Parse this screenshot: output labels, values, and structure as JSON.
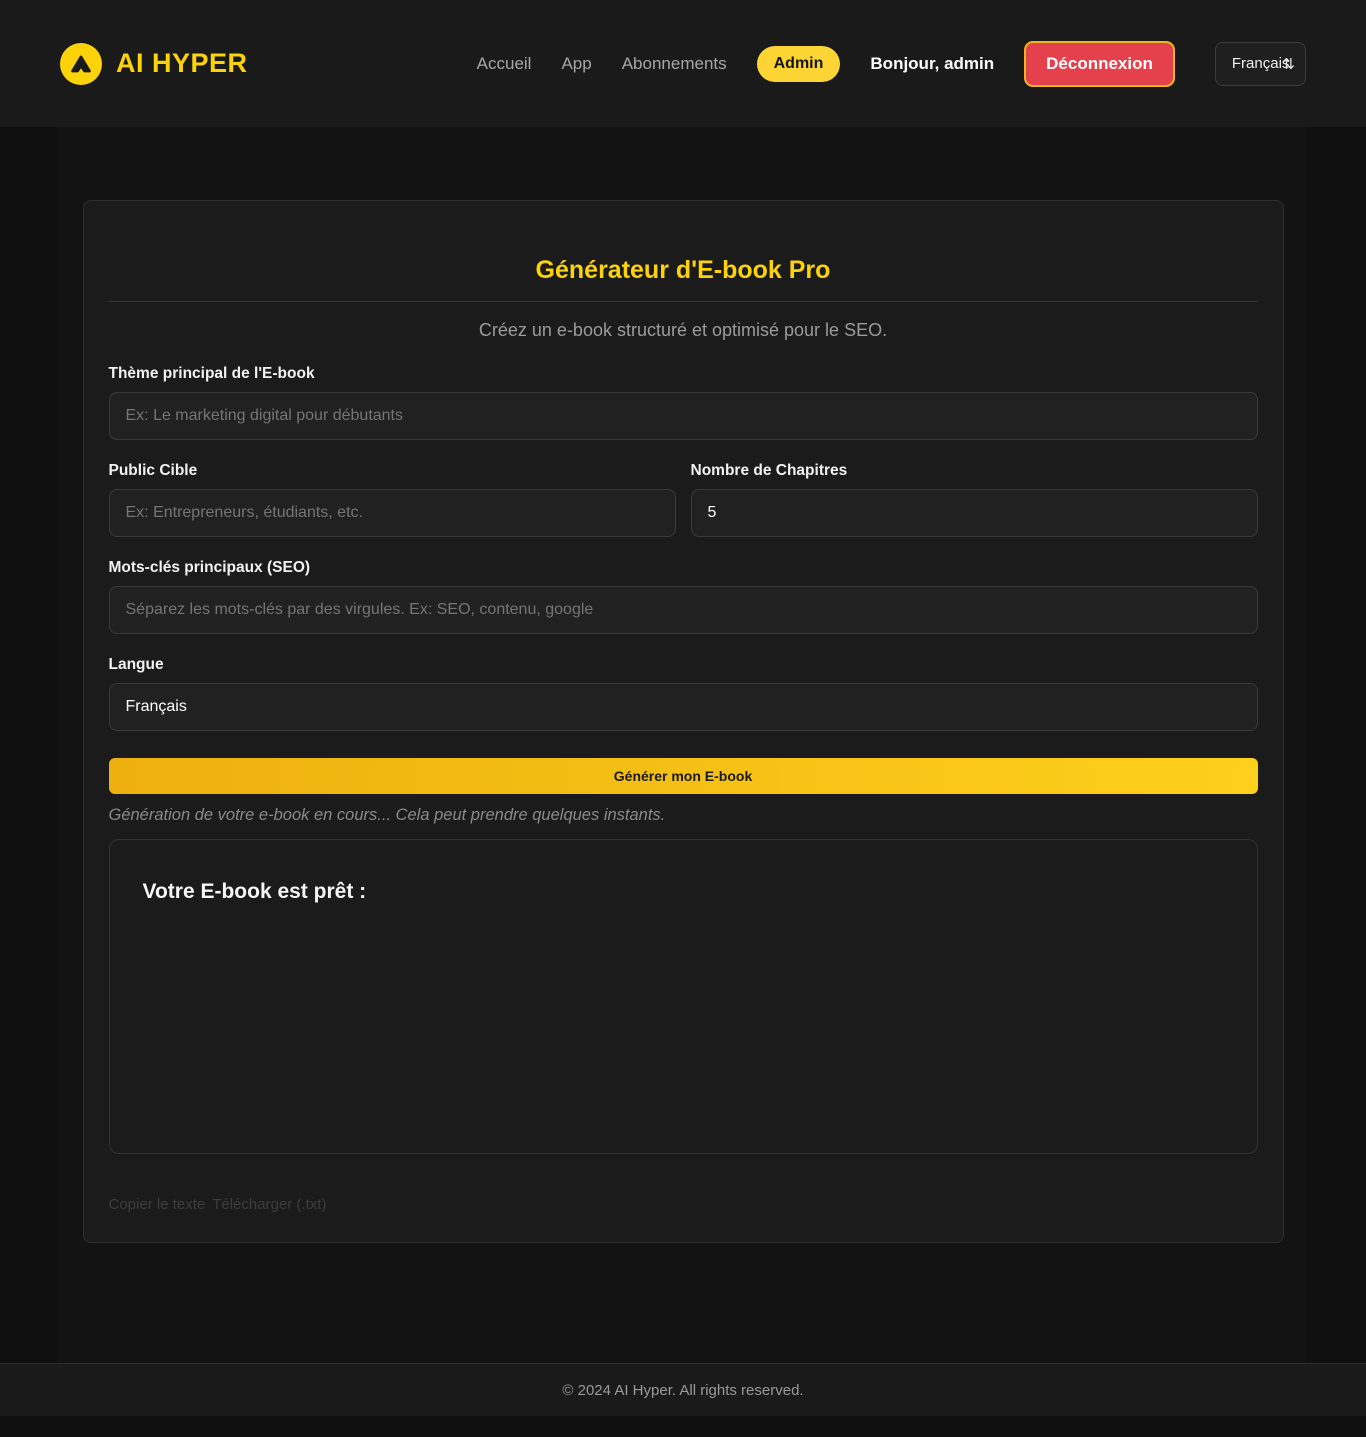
{
  "header": {
    "brand": "AI HYPER",
    "nav": [
      {
        "label": "Accueil"
      },
      {
        "label": "App"
      },
      {
        "label": "Abonnements"
      }
    ],
    "admin_badge": "Admin",
    "greeting": "Bonjour, admin",
    "logout_label": "Déconnexion",
    "language_selector": {
      "selected": "Français"
    }
  },
  "generator": {
    "title": "Générateur d'E-book Pro",
    "subtitle": "Créez un e-book structuré et optimisé pour le SEO.",
    "fields": {
      "theme": {
        "label": "Thème principal de l'E-book",
        "placeholder": "Ex: Le marketing digital pour débutants",
        "value": ""
      },
      "audience": {
        "label": "Public Cible",
        "placeholder": "Ex: Entrepreneurs, étudiants, etc.",
        "value": ""
      },
      "chapters": {
        "label": "Nombre de Chapitres",
        "value": "5"
      },
      "keywords": {
        "label": "Mots-clés principaux (SEO)",
        "placeholder": "Séparez les mots-clés par des virgules. Ex: SEO, contenu, google",
        "value": ""
      },
      "language": {
        "label": "Langue",
        "selected": "Français"
      }
    },
    "generate_button": "Générer mon E-book",
    "status": "Génération de votre e-book en cours... Cela peut prendre quelques instants.",
    "result": {
      "heading": "Votre E-book est prêt :"
    },
    "actions": {
      "copy": "Copier le texte",
      "download": "Télécharger (.txt)"
    }
  },
  "footer": {
    "copyright": "© 2024 AI Hyper. All rights reserved."
  },
  "colors": {
    "accent": "#fcd20b",
    "accent_gradient_start": "#edb00e",
    "accent_gradient_end": "#fdd01c",
    "danger": "#e5414d",
    "header_bg": "#1a1a1a",
    "card_bg": "#1b1b1b",
    "input_bg": "#212121"
  }
}
